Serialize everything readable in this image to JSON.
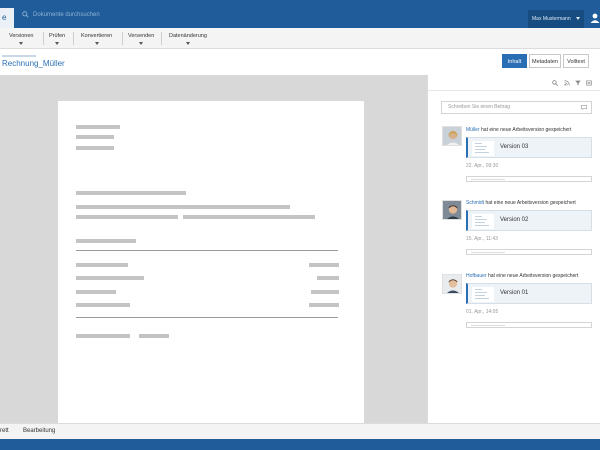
{
  "header": {
    "start_label": "e",
    "search_placeholder": "Dokumente durchsuchen",
    "user_name": "Max Mustermann"
  },
  "menu": {
    "items": [
      {
        "label": "Versionen"
      },
      {
        "label": "Prüfen"
      },
      {
        "label": "Konvertieren"
      },
      {
        "label": "Versenden"
      },
      {
        "label": "Datenänderung"
      }
    ]
  },
  "document": {
    "title": "Rechnung_Müller"
  },
  "tabs": [
    {
      "label": "Inhalt",
      "active": true
    },
    {
      "label": "Metadaten",
      "active": false
    },
    {
      "label": "Volltext",
      "active": false
    }
  ],
  "activity": {
    "comment_placeholder": "Schreiben Sie einen Beitrag",
    "entries": [
      {
        "user": "Müller",
        "action": "hat eine neue Arbeitsversion gespeichert",
        "version": "Version 03",
        "time": "22. Apr., 09:30"
      },
      {
        "user": "Schmidt",
        "action": "hat eine neue Arbeitsversion gespeichert",
        "version": "Version 02",
        "time": "15. Apr., 11:43"
      },
      {
        "user": "Hofbauer",
        "action": "hat eine neue Arbeitsversion gespeichert",
        "version": "Version 01",
        "time": "01. Apr., 14:05"
      }
    ]
  },
  "statusbar": {
    "items": [
      {
        "label": "rett"
      },
      {
        "label": "Bearbeitung"
      }
    ]
  },
  "colors": {
    "primary": "#1f5c99",
    "accent": "#2a6fb3",
    "viewer_bg": "#d8d8d8"
  }
}
